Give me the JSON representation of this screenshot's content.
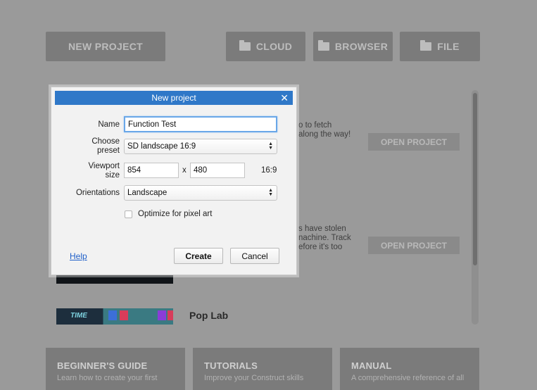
{
  "top_buttons": {
    "new_project": "NEW PROJECT",
    "cloud": "CLOUD",
    "browser": "BROWSER",
    "file": "FILE"
  },
  "background": {
    "item1_text_lines": [
      "o to fetch",
      "along the way!"
    ],
    "item2_text_lines": [
      "s have stolen",
      "nachine. Track",
      "efore it's too"
    ],
    "open_project_label": "OPEN PROJECT",
    "poplab_title": "Pop Lab",
    "poplab_thumb_text": "TIME"
  },
  "bottom_cards": [
    {
      "title": "BEGINNER'S GUIDE",
      "desc": "Learn how to create your first"
    },
    {
      "title": "TUTORIALS",
      "desc": "Improve your Construct skills"
    },
    {
      "title": "MANUAL",
      "desc": "A comprehensive reference of all"
    }
  ],
  "dialog": {
    "title": "New project",
    "close_glyph": "✕",
    "name_label": "Name",
    "name_value": "Function Test",
    "preset_label_1": "Choose",
    "preset_label_2": "preset",
    "preset_value": "SD landscape 16:9",
    "viewport_label_1": "Viewport",
    "viewport_label_2": "size",
    "viewport_width": "854",
    "viewport_x": "x",
    "viewport_height": "480",
    "aspect_ratio": "16:9",
    "orientations_label": "Orientations",
    "orientations_value": "Landscape",
    "pixel_art_label": "Optimize for pixel art",
    "pixel_art_checked": false,
    "help_label": "Help",
    "create_label": "Create",
    "cancel_label": "Cancel"
  },
  "colors": {
    "title_bar": "#2f78c8",
    "overlay_bg": "#9a9a9a",
    "focus_ring": "#6aa7e8",
    "link": "#1f5fc8"
  }
}
